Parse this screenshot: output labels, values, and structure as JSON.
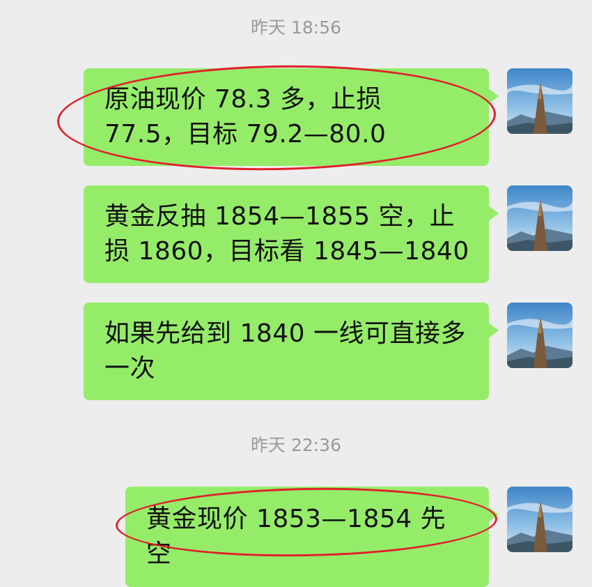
{
  "timestamps": {
    "t1": "昨天 18:56",
    "t2": "昨天 22:36"
  },
  "messages": [
    {
      "text": "原油现价 78.3 多，止损 77.5，目标 79.2—80.0",
      "highlighted": true
    },
    {
      "text": "黄金反抽 1854—1855 空，止损 1860，目标看 1845—1840",
      "highlighted": false
    },
    {
      "text": "如果先给到 1840 一线可直接多一次",
      "highlighted": false
    },
    {
      "text": "黄金现价 1853—1854 先空",
      "highlighted": true
    }
  ],
  "colors": {
    "background": "#ededed",
    "bubble": "#95ec69",
    "annotation": "#e0202a",
    "timestamp": "#9a9a9a"
  },
  "avatar_icon": "mountain-peak-photo"
}
